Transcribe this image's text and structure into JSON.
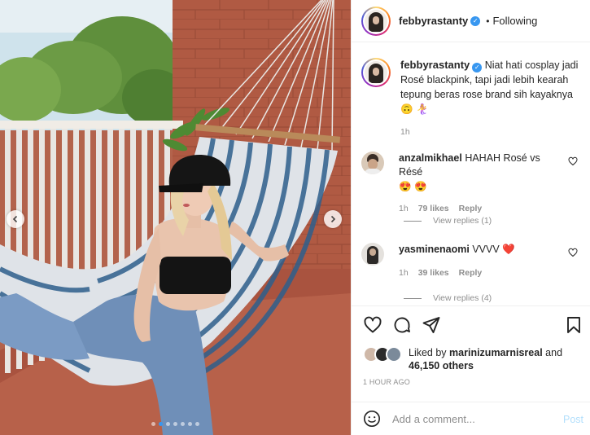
{
  "post": {
    "author": "febbyrastanty",
    "header_separator": "•",
    "follow_status": "Following",
    "caption": "Niat hati cosplay jadi Rosé blackpink, tapi jadi lebih kearah tepung beras rose brand sih kayaknya 🙃 🧜‍♀️",
    "caption_time": "1h",
    "image_count": 7,
    "active_image_index": 1
  },
  "comments": [
    {
      "username": "anzalmikhael",
      "text": "HAHAH Rosé vs Résé",
      "emoji": "😍 😍",
      "time": "1h",
      "likes": "79 likes",
      "reply_label": "Reply",
      "view_replies": "View replies (1)"
    },
    {
      "username": "yasminenaomi",
      "text": "VVVV",
      "emoji": "❤️",
      "time": "1h",
      "likes": "39 likes",
      "reply_label": "Reply",
      "view_replies": "View replies (4)"
    }
  ],
  "engagement": {
    "liked_by_prefix": "Liked by",
    "liked_by_user": "marinizumarnisreal",
    "liked_and": "and",
    "others": "46,150 others",
    "posted_ago": "1 HOUR AGO"
  },
  "composer": {
    "placeholder": "Add a comment...",
    "post_label": "Post"
  },
  "icons": {
    "like": "heart-icon",
    "comment": "comment-icon",
    "share": "paper-plane-icon",
    "save": "bookmark-icon",
    "emoji": "emoji-icon",
    "prev": "chevron-left-icon",
    "next": "chevron-right-icon",
    "verified": "verified-badge-icon"
  },
  "colors": {
    "accent": "#3897f0",
    "heart_red": "#ed4956",
    "muted": "#8e8e8e",
    "post_disabled": "#b2dffc"
  }
}
